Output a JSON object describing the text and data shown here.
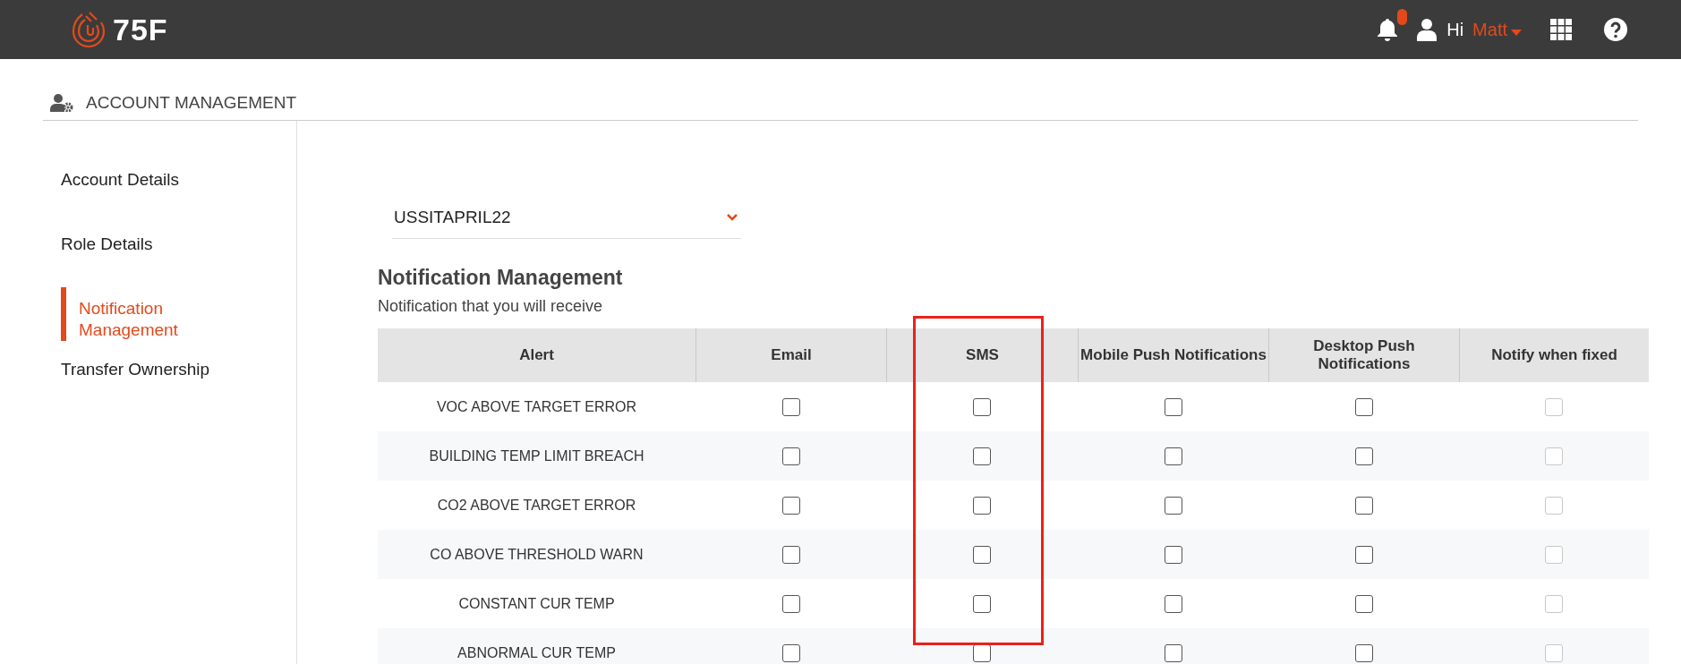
{
  "header": {
    "logo_text": "75F",
    "notification_badge": true,
    "greeting": "Hi",
    "user_name": "Matt"
  },
  "page_title": "ACCOUNT MANAGEMENT",
  "sidebar": {
    "items": [
      {
        "label": "Account Details",
        "selected": false
      },
      {
        "label": "Role Details",
        "selected": false
      },
      {
        "label": "Notification Management",
        "selected": true
      },
      {
        "label": "Transfer Ownership",
        "selected": false
      }
    ]
  },
  "site_select": {
    "value": "USSITAPRIL22"
  },
  "section": {
    "title": "Notification Management",
    "subtitle": "Notification that you will receive"
  },
  "table": {
    "columns": [
      {
        "label": "Alert",
        "highlighted": false
      },
      {
        "label": "Email",
        "highlighted": false
      },
      {
        "label": "SMS",
        "highlighted": true
      },
      {
        "label": "Mobile Push Notifications",
        "highlighted": false
      },
      {
        "label": "Desktop Push Notifications",
        "highlighted": false
      },
      {
        "label": "Notify when fixed",
        "highlighted": false
      }
    ],
    "rows": [
      {
        "alert": "VOC ABOVE TARGET ERROR",
        "options": [
          {
            "checked": false,
            "disabled": false
          },
          {
            "checked": false,
            "disabled": false
          },
          {
            "checked": false,
            "disabled": false
          },
          {
            "checked": false,
            "disabled": false
          },
          {
            "checked": false,
            "disabled": true
          }
        ]
      },
      {
        "alert": "BUILDING TEMP LIMIT BREACH",
        "options": [
          {
            "checked": false,
            "disabled": false
          },
          {
            "checked": false,
            "disabled": false
          },
          {
            "checked": false,
            "disabled": false
          },
          {
            "checked": false,
            "disabled": false
          },
          {
            "checked": false,
            "disabled": true
          }
        ]
      },
      {
        "alert": "CO2 ABOVE TARGET ERROR",
        "options": [
          {
            "checked": false,
            "disabled": false
          },
          {
            "checked": false,
            "disabled": false
          },
          {
            "checked": false,
            "disabled": false
          },
          {
            "checked": false,
            "disabled": false
          },
          {
            "checked": false,
            "disabled": true
          }
        ]
      },
      {
        "alert": "CO ABOVE THRESHOLD WARN",
        "options": [
          {
            "checked": false,
            "disabled": false
          },
          {
            "checked": false,
            "disabled": false
          },
          {
            "checked": false,
            "disabled": false
          },
          {
            "checked": false,
            "disabled": false
          },
          {
            "checked": false,
            "disabled": true
          }
        ]
      },
      {
        "alert": "CONSTANT CUR TEMP",
        "options": [
          {
            "checked": false,
            "disabled": false
          },
          {
            "checked": false,
            "disabled": false
          },
          {
            "checked": false,
            "disabled": false
          },
          {
            "checked": false,
            "disabled": false
          },
          {
            "checked": false,
            "disabled": true
          }
        ]
      },
      {
        "alert": "ABNORMAL CUR TEMP",
        "options": [
          {
            "checked": false,
            "disabled": false
          },
          {
            "checked": false,
            "disabled": false
          },
          {
            "checked": false,
            "disabled": false
          },
          {
            "checked": false,
            "disabled": false
          },
          {
            "checked": false,
            "disabled": true
          }
        ]
      }
    ]
  }
}
